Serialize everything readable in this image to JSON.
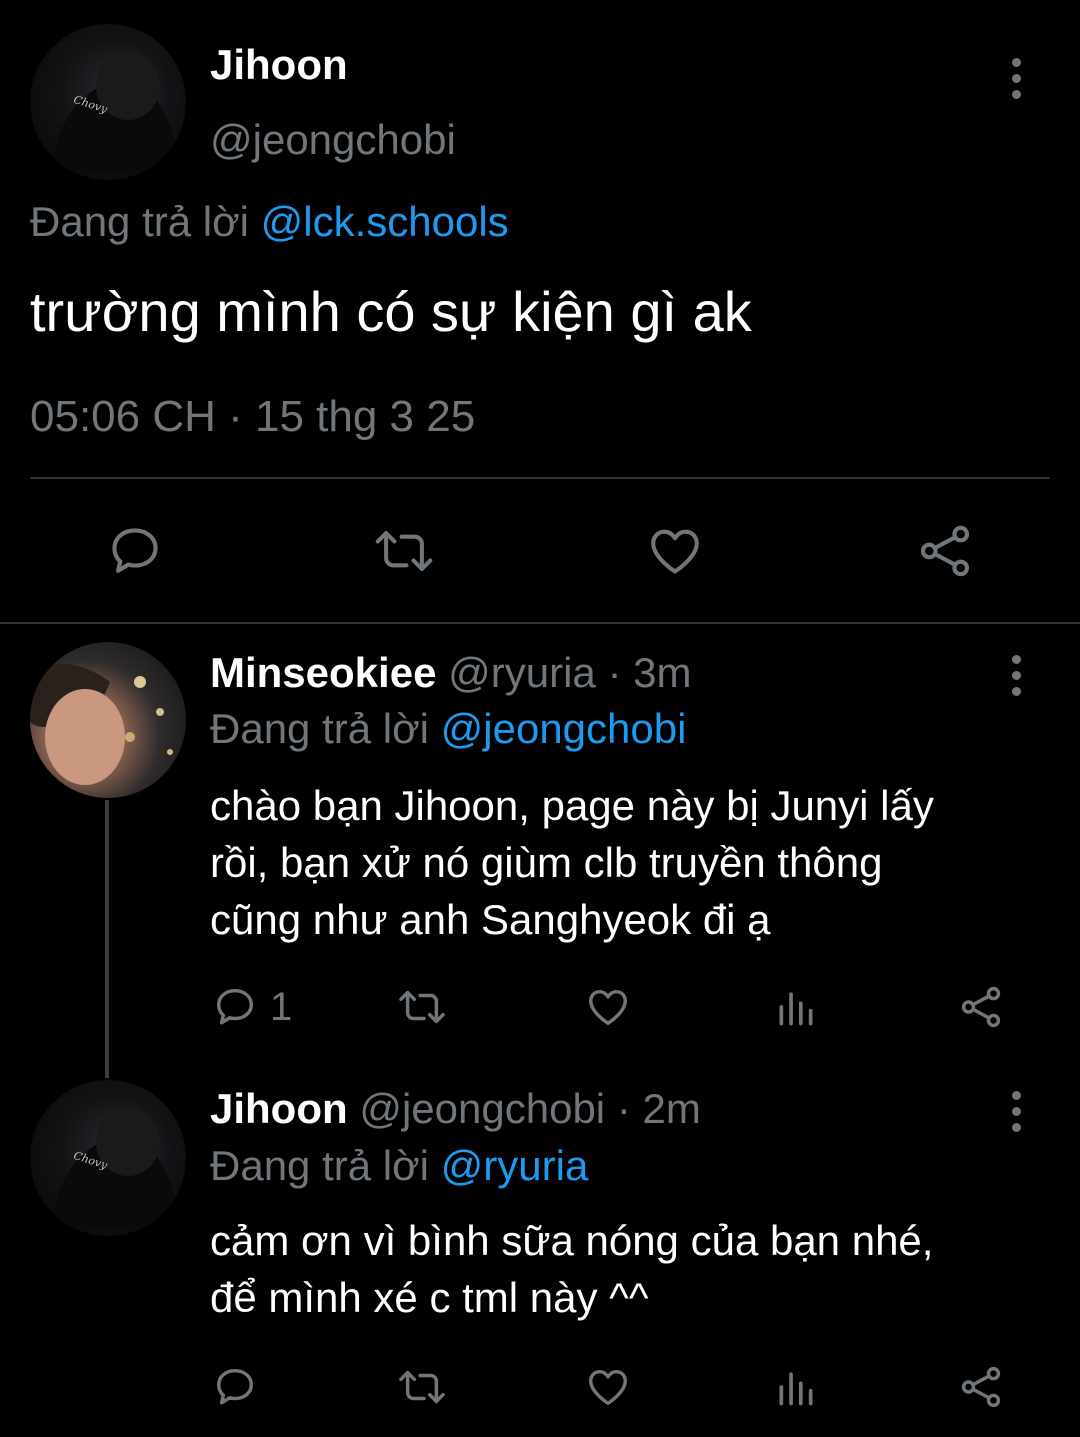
{
  "main_tweet": {
    "display_name": "Jihoon",
    "handle": "@jeongchobi",
    "replying_prefix": "Đang trả lời",
    "replying_to": "@lck.schools",
    "text": "trường mình có sự kiện gì ak",
    "timestamp": "05:06 CH · 15 thg 3 25"
  },
  "replies": [
    {
      "display_name": "Minseokiee",
      "handle": "@ryuria",
      "time": "· 3m",
      "replying_prefix": "Đang trả lời",
      "replying_to": "@jeongchobi",
      "text_lines": [
        "chào bạn Jihoon, page này bị Junyi lấy",
        "rồi, bạn xử nó giùm clb truyền thông",
        "cũng như anh Sanghyeok đi ạ"
      ],
      "reply_count": "1"
    },
    {
      "display_name": "Jihoon",
      "handle": "@jeongchobi",
      "time": "· 2m",
      "replying_prefix": "Đang trả lời",
      "replying_to": "@ryuria",
      "text_lines": [
        "cảm ơn vì bình sữa nóng của bạn nhé,",
        "để mình xé c tml này ^^"
      ]
    }
  ],
  "icons": [
    "reply-icon",
    "retweet-icon",
    "like-icon",
    "share-icon",
    "views-icon",
    "more-icon"
  ],
  "colors": {
    "background": "#000000",
    "text": "#e7e9ea",
    "muted": "#71767b",
    "link": "#1d9bf0",
    "divider": "#2f3336"
  }
}
